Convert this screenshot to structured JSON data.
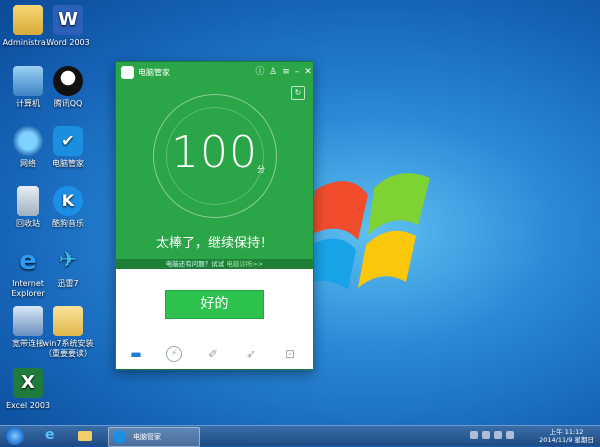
{
  "desktop": {
    "icons": [
      {
        "label": "Administra...",
        "icon": "user-folder-icon"
      },
      {
        "label": "Word 2003",
        "icon": "word-icon"
      },
      {
        "label": "计算机",
        "icon": "computer-icon"
      },
      {
        "label": "腾讯QQ",
        "icon": "qq-icon"
      },
      {
        "label": "网络",
        "icon": "network-icon"
      },
      {
        "label": "电脑管家",
        "icon": "shield-icon"
      },
      {
        "label": "回收站",
        "icon": "recycle-bin-icon"
      },
      {
        "label": "酷狗音乐",
        "icon": "kugou-icon"
      },
      {
        "label": "Internet Explorer",
        "icon": "ie-icon"
      },
      {
        "label": "迅雷7",
        "icon": "thunder-icon"
      },
      {
        "label": "宽带连接",
        "icon": "broadband-icon"
      },
      {
        "label": "win7系统安装（重要要读）",
        "icon": "folder-icon"
      },
      {
        "label": "Excel 2003",
        "icon": "excel-icon"
      }
    ]
  },
  "app": {
    "title": "电脑管家",
    "score": "100",
    "score_unit": "分",
    "message": "太棒了，继续保持！",
    "hint_text": "电脑还有问题？试试",
    "hint_link": "电脑诊所>>",
    "ok_button": "好的",
    "accent": "#2aa548"
  },
  "taskbar": {
    "app_label": "电脑管家",
    "time": "上午 11:12",
    "date": "2014/11/9 星期日"
  }
}
